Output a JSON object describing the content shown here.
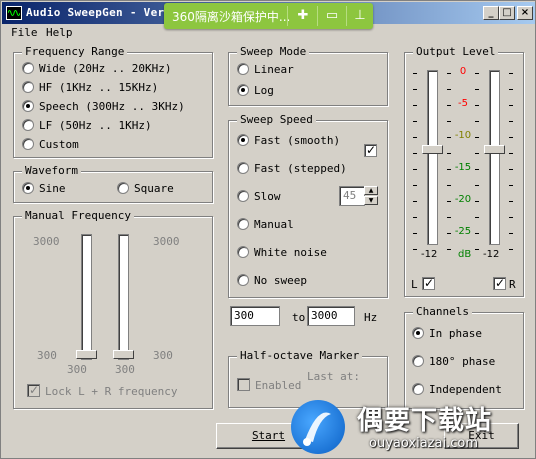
{
  "window": {
    "title": "Audio SweepGen - Ver:",
    "minimize": "_",
    "maximize": "□",
    "close": "×"
  },
  "overlay": {
    "text": "360隔离沙箱保护中..."
  },
  "menu": {
    "file": "File",
    "help": "Help"
  },
  "frequency_range": {
    "title": "Frequency Range",
    "options": [
      {
        "label": "Wide   (20Hz .. 20KHz)",
        "selected": false
      },
      {
        "label": "HF   (1KHz .. 15KHz)",
        "selected": false
      },
      {
        "label": "Speech  (300Hz .. 3KHz)",
        "selected": true
      },
      {
        "label": "LF   (50Hz .. 1KHz)",
        "selected": false
      },
      {
        "label": "Custom",
        "selected": false
      }
    ]
  },
  "waveform": {
    "title": "Waveform",
    "sine": "Sine",
    "square": "Square",
    "selected": "sine"
  },
  "manual_frequency": {
    "title": "Manual Frequency",
    "top_left": "3000",
    "top_right": "3000",
    "bottom_left": "300",
    "bottom_left_inner": "300",
    "bottom_right_inner": "300",
    "bottom_right": "300",
    "lock_label": "Lock L + R frequency",
    "lock_checked": true
  },
  "sweep_mode": {
    "title": "Sweep Mode",
    "linear": "Linear",
    "log": "Log",
    "selected": "log"
  },
  "sweep_speed": {
    "title": "Sweep Speed",
    "options": [
      {
        "label": "Fast (smooth)",
        "selected": true
      },
      {
        "label": "Fast (stepped)",
        "selected": false
      },
      {
        "label": "Slow",
        "selected": false
      },
      {
        "label": "Manual",
        "selected": false
      },
      {
        "label": "White noise",
        "selected": false
      },
      {
        "label": "No sweep",
        "selected": false
      }
    ],
    "smooth_checked": true,
    "slow_value": "45"
  },
  "range": {
    "from": "300",
    "to_label": "to",
    "to": "3000",
    "unit": "Hz"
  },
  "half_octave": {
    "title": "Half-octave Marker",
    "enabled_label": "Enabled",
    "last_at_label": "Last at:"
  },
  "output_level": {
    "title": "Output Level",
    "scale": [
      "0",
      "-5",
      "-10",
      "-15",
      "-20",
      "-25"
    ],
    "scale_colors": [
      "#ff0000",
      "#ff0000",
      "#808000",
      "#008000",
      "#008000",
      "#008000"
    ],
    "left_bottom": "-12",
    "right_bottom": "-12",
    "unit": "dB",
    "left_label": "L",
    "right_label": "R",
    "left_checked": true,
    "right_checked": true
  },
  "channels": {
    "title": "Channels",
    "options": [
      {
        "label": "In phase",
        "selected": true
      },
      {
        "label": "180°  phase",
        "selected": false
      },
      {
        "label": "Independent",
        "selected": false
      }
    ]
  },
  "buttons": {
    "start": "Start",
    "exit": "Exit"
  },
  "watermark": {
    "big": "偶要下载站",
    "small": "ouyaoxiazai.com"
  }
}
